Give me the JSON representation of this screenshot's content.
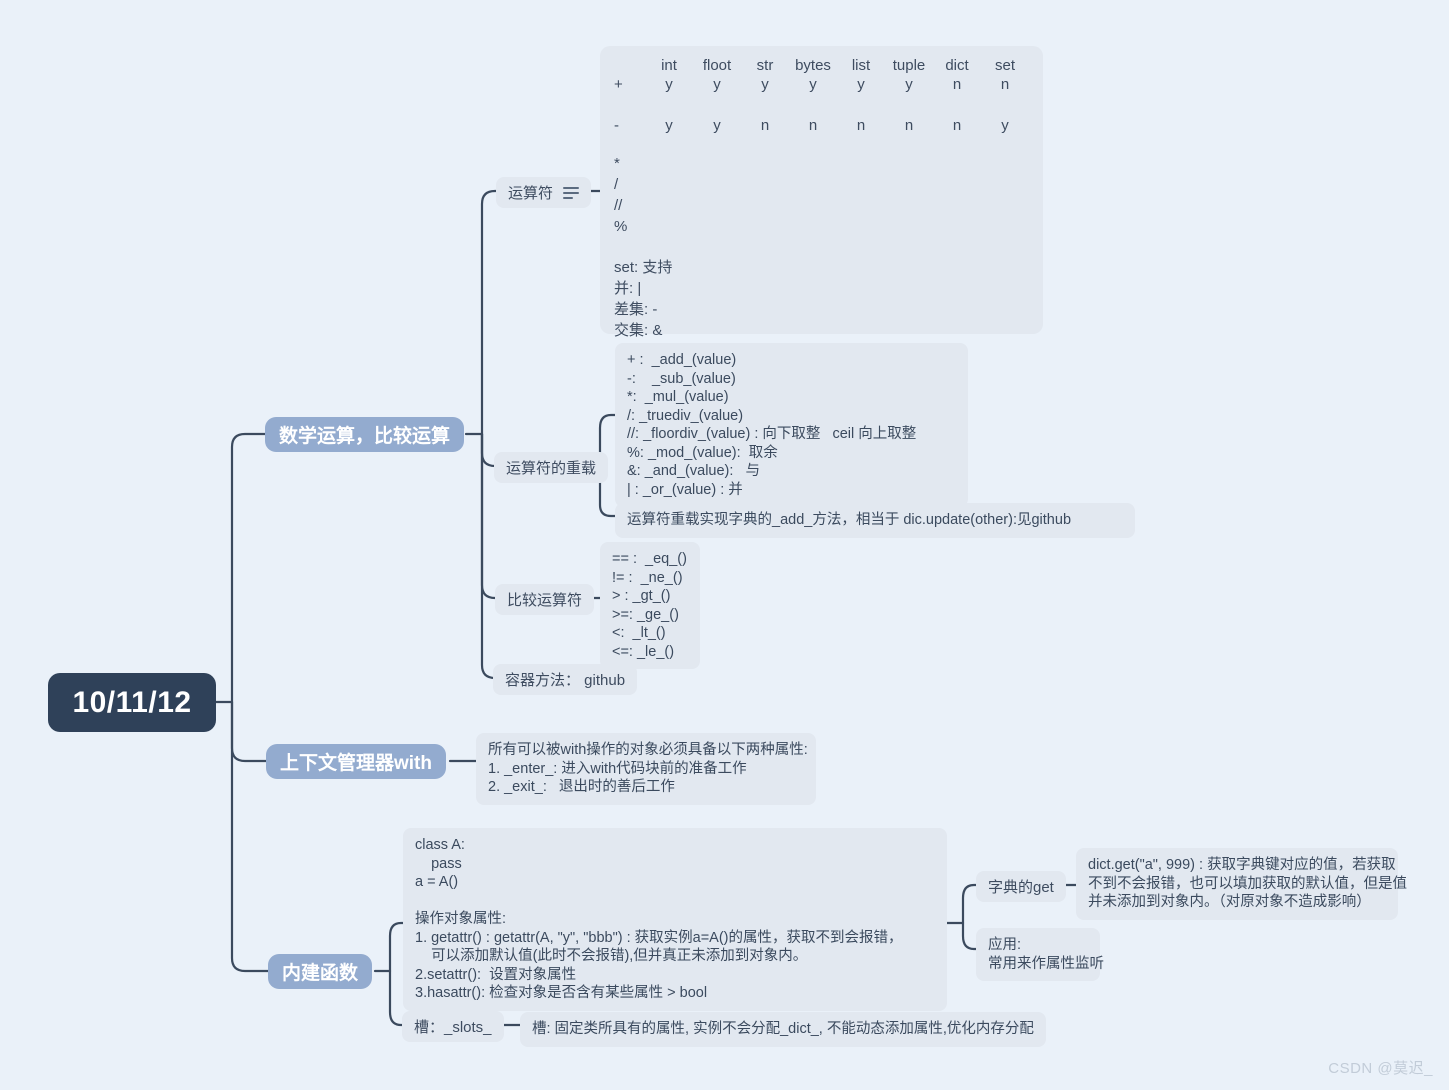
{
  "page": {
    "background": "#eaf1f9",
    "watermark": "CSDN @莫迟_"
  },
  "colors": {
    "root_bg": "#2f4159",
    "level1_bg": "#93abcf",
    "leaf_bg": "#e2e8f0",
    "line": "#3b4a5e",
    "text": "#3b4a5e"
  },
  "root": {
    "label": "10/11/12"
  },
  "branches": [
    {
      "id": "math",
      "label": "数学运算，比较运算"
    },
    {
      "id": "with",
      "label": "上下文管理器with"
    },
    {
      "id": "builtin",
      "label": "内建函数"
    }
  ],
  "math": {
    "children": [
      {
        "id": "operators",
        "label": "运算符",
        "icon": "note-lines-icon"
      },
      {
        "id": "overload",
        "label": "运算符的重载"
      },
      {
        "id": "compare",
        "label": "比较运算符"
      },
      {
        "id": "container",
        "label": "容器方法： github"
      }
    ]
  },
  "operator_table": {
    "columns": [
      "int",
      "floot",
      "str",
      "bytes",
      "list",
      "tuple",
      "dict",
      "set"
    ],
    "rows": [
      {
        "op": "+",
        "values": [
          "y",
          "y",
          "y",
          "y",
          "y",
          "y",
          "n",
          "n"
        ]
      },
      {
        "op": "-",
        "values": [
          "y",
          "y",
          "n",
          "n",
          "n",
          "n",
          "n",
          "y"
        ]
      }
    ],
    "extra_ops": "*\n/\n//\n%",
    "set_note": "set: 支持\n并: |\n差集: -\n交集: &"
  },
  "overload_leaf": {
    "text": "+ :  _add_(value)\n-:    _sub_(value)\n*:  _mul_(value)\n/: _truediv_(value)\n//: _floordiv_(value) : 向下取整   ceil 向上取整\n%: _mod_(value):  取余\n&: _and_(value):   与\n| : _or_(value) : 并"
  },
  "overload_note": {
    "text": "运算符重载实现字典的_add_方法，相当于 dic.update(other):见github"
  },
  "compare_leaf": {
    "text": "== :  _eq_()\n!= :  _ne_()\n> : _gt_()\n>=: _ge_()\n<:  _lt_()\n<=: _le_()"
  },
  "with_leaf": {
    "text": "所有可以被with操作的对象必须具备以下两种属性:\n1. _enter_: 进入with代码块前的准备工作\n2. _exit_:   退出时的善后工作"
  },
  "builtin": {
    "children": [
      {
        "id": "attrs",
        "label": "操作对象属性"
      },
      {
        "id": "slots",
        "label": "槽：_slots_"
      }
    ]
  },
  "builtin_leaf": {
    "text": "class A:\n    pass\na = A()\n\n操作对象属性:\n1. getattr() : getattr(A, \"y\", \"bbb\") : 获取实例a=A()的属性，获取不到会报错，\n    可以添加默认值(此时不会报错),但并真正未添加到对象内。\n2.setattr():  设置对象属性\n3.hasattr(): 检查对象是否含有某些属性 > bool"
  },
  "dict_get": {
    "label": "字典的get",
    "text": "dict.get(\"a\", 999) : 获取字典键对应的值，若获取\n不到不会报错，也可以填加获取的默认值，但是值\n并未添加到对象内。（对原对象不造成影响）"
  },
  "apply": {
    "text": "应用:\n常用来作属性监听"
  },
  "slots": {
    "label": "槽：_slots_",
    "text": "槽: 固定类所具有的属性, 实例不会分配_dict_, 不能动态添加属性,优化内存分配"
  }
}
